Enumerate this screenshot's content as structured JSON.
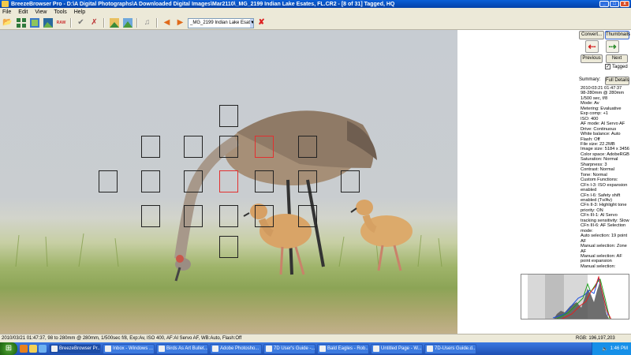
{
  "window": {
    "title": "BreezeBrowser Pro - D:\\A Digital Photographs\\A Downloaded Digital Images\\Mar2110\\_MG_2199  Indian Lake Esates, FL.CR2 - [8 of 31] Tagged, HQ",
    "minimize": "_",
    "maximize": "□",
    "close": "x"
  },
  "menu": [
    "File",
    "Edit",
    "View",
    "Tools",
    "Help"
  ],
  "toolbar": {
    "file_selector_value": "_MG_2199  Indian Lake Esat",
    "raw_label": "RAW",
    "icons": [
      "open-folder-icon",
      "grid-icon",
      "thumbnail-icon",
      "picture-icon",
      "raw-icon",
      "checkmark-icon",
      "tools-icon",
      "image-icon",
      "image-export-icon",
      "music-icon",
      "left-arrow-icon",
      "right-arrow-icon",
      "cross-icon"
    ]
  },
  "sidebar": {
    "convert_label": "Convert...",
    "thumbnails_label": "Thumbnails",
    "previous_label": "Previous",
    "next_label": "Next",
    "tagged_label": "Tagged",
    "tagged_checked": true,
    "summary_label": "Summary:",
    "full_details_label": "Full Details",
    "metadata": [
      "2010:03:21 01:47:37",
      "98-280mm @ 280mm",
      "1/500 sec, f/8",
      "Mode: Av",
      "Metering: Evaluative",
      "Exp comp: +1",
      "ISO: 400",
      "AF mode: AI Servo AF",
      "Drive: Continuous",
      "White balance: Auto",
      "Flash: Off",
      "File size: 22.2MB",
      "Image size: 5184 x 3456",
      "Color space: AdobeRGB",
      "Saturation: Normal",
      "Sharpness: 3",
      "Contrast: Normal",
      "Tone: Normal",
      "Custom Functions:",
      "CFn I-3: ISO expansion enabled",
      "CFn I-6: Safety shift enabled (Tv/Av)",
      "CFn II-3: Highlight tone priority: ON",
      "CFn III-1: AI Servo tracking sensitivity: Slow",
      "CFn III-6: AF Selection mode:",
      "  Auto selection: 19 point AF",
      "  Manual selection: Zone AF",
      "  Manual selection: AF point expansion",
      "  Manual selection:"
    ]
  },
  "status": {
    "info": "2010/03/21 01:47:37, 98 to 280mm @ 280mm, 1/500sec f/8, Exp:Av, ISO 400, AF:AI Servo AF, WB:Auto, Flash:Off",
    "rgb": "RGB: 196,197,203"
  },
  "taskbar": {
    "start_label": "⊞",
    "tasks": [
      "BreezeBrowser Pr...",
      "Inbox - Windows ...",
      "Birds As Art Bullet...",
      "Adobe Photosho...",
      "7D User's Guide -...",
      "Bald Eagles - Rob...",
      "Untitled Page - W...",
      "7D-Users Guide.d..."
    ],
    "clock": "1:46 PM"
  },
  "colors": {
    "af_selected": "#e23030",
    "af_normal": "#222222",
    "title_bar": "#0a5fd8",
    "taskbar": "#245edb"
  }
}
